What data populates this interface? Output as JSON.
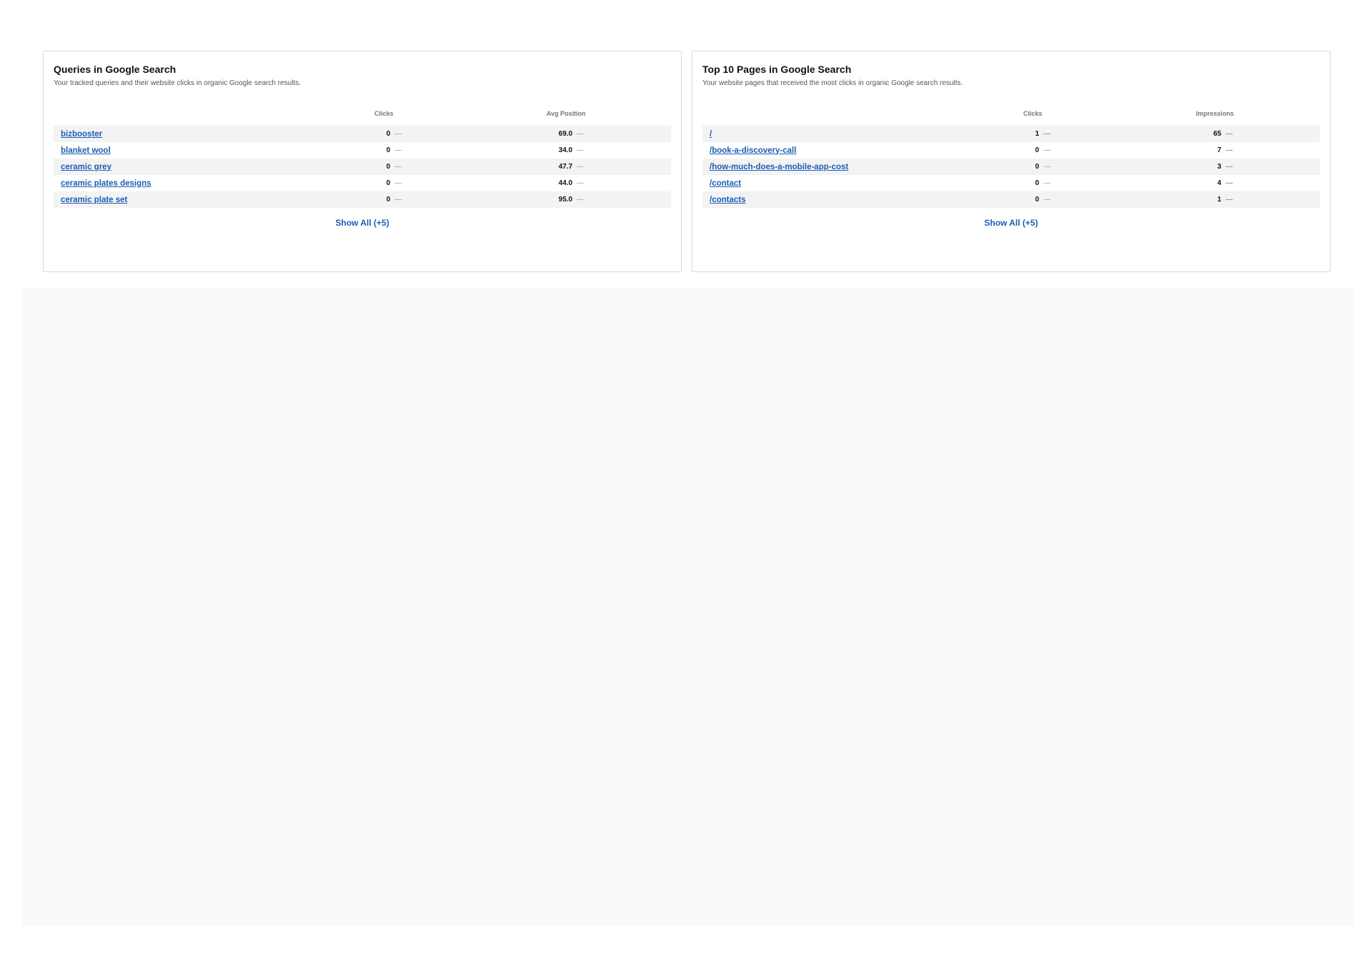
{
  "queries_card": {
    "title": "Queries in Google Search",
    "subtitle": "Your tracked queries and their website clicks in organic Google search results.",
    "columns": [
      "",
      "Clicks",
      "Avg Position"
    ],
    "rows": [
      {
        "name": "bizbooster",
        "clicks": "0",
        "clicks_trend": "—",
        "value": "69.0",
        "value_trend": "—"
      },
      {
        "name": "blanket wool",
        "clicks": "0",
        "clicks_trend": "—",
        "value": "34.0",
        "value_trend": "—"
      },
      {
        "name": "ceramic grey",
        "clicks": "0",
        "clicks_trend": "—",
        "value": "47.7",
        "value_trend": "—"
      },
      {
        "name": "ceramic plates designs",
        "clicks": "0",
        "clicks_trend": "—",
        "value": "44.0",
        "value_trend": "—"
      },
      {
        "name": "ceramic plate set",
        "clicks": "0",
        "clicks_trend": "—",
        "value": "95.0",
        "value_trend": "—"
      }
    ],
    "show_all_label": "Show All (+5)"
  },
  "pages_card": {
    "title": "Top 10 Pages in Google Search",
    "subtitle": "Your website pages that received the most clicks in organic Google search results.",
    "columns": [
      "",
      "Clicks",
      "Impressions"
    ],
    "rows": [
      {
        "name": "/",
        "clicks": "1",
        "clicks_trend": "—",
        "value": "65",
        "value_trend": "—"
      },
      {
        "name": "/book-a-discovery-call",
        "clicks": "0",
        "clicks_trend": "—",
        "value": "7",
        "value_trend": "—"
      },
      {
        "name": "/how-much-does-a-mobile-app-cost",
        "clicks": "0",
        "clicks_trend": "—",
        "value": "3",
        "value_trend": "—"
      },
      {
        "name": "/contact",
        "clicks": "0",
        "clicks_trend": "—",
        "value": "4",
        "value_trend": "—"
      },
      {
        "name": "/contacts",
        "clicks": "0",
        "clicks_trend": "—",
        "value": "1",
        "value_trend": "—"
      }
    ],
    "show_all_label": "Show All (+5)"
  },
  "colors": {
    "link": "#1a5fb4",
    "trend_neutral": "#999999",
    "trend_up": "#1e9e3a",
    "row_shade": "#f3f3f3",
    "panel_bg": "#f9f9f9"
  }
}
